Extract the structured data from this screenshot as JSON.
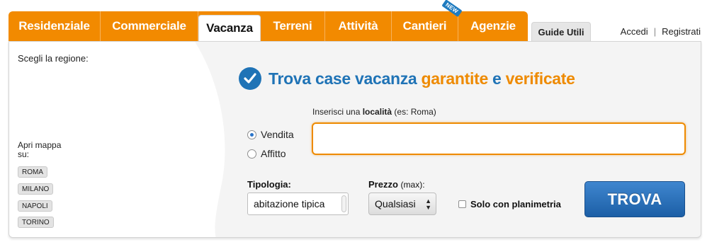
{
  "tabs": [
    {
      "label": "Residenziale"
    },
    {
      "label": "Commerciale"
    },
    {
      "label": "Vacanza",
      "active": true
    },
    {
      "label": "Terreni"
    },
    {
      "label": "Attività"
    },
    {
      "label": "Cantieri",
      "badge": "NEW"
    },
    {
      "label": "Agenzie"
    }
  ],
  "guide_tab": "Guide Utili",
  "user_links": {
    "login": "Accedi",
    "separator": "|",
    "register": "Registrati"
  },
  "map": {
    "region_label": "Scegli la regione:",
    "open_map_label": "Apri mappa su:",
    "cities": [
      "ROMA",
      "MILANO",
      "NAPOLI",
      "TORINO"
    ]
  },
  "heading": {
    "part1": "Trova case vacanza",
    "part2": "garantite",
    "part3": "e",
    "part4": "verificate",
    "icon": "check-circle-icon"
  },
  "search": {
    "radios": [
      {
        "label": "Vendita",
        "checked": true
      },
      {
        "label": "Affitto",
        "checked": false
      }
    ],
    "location_label_prefix": "Inserisci una",
    "location_label_bold": "località",
    "location_label_hint": "(es: Roma)",
    "location_value": "",
    "tipologia_label": "Tipologia:",
    "tipologia_value": "abitazione tipica",
    "prezzo_label": "Prezzo",
    "prezzo_hint": "(max):",
    "prezzo_value": "Qualsiasi",
    "planimetria_label": "Solo con planimetria",
    "submit_label": "TROVA"
  },
  "colors": {
    "orange": "#f28a00",
    "blue": "#1f73b6",
    "button_blue": "#2a6fb8"
  }
}
